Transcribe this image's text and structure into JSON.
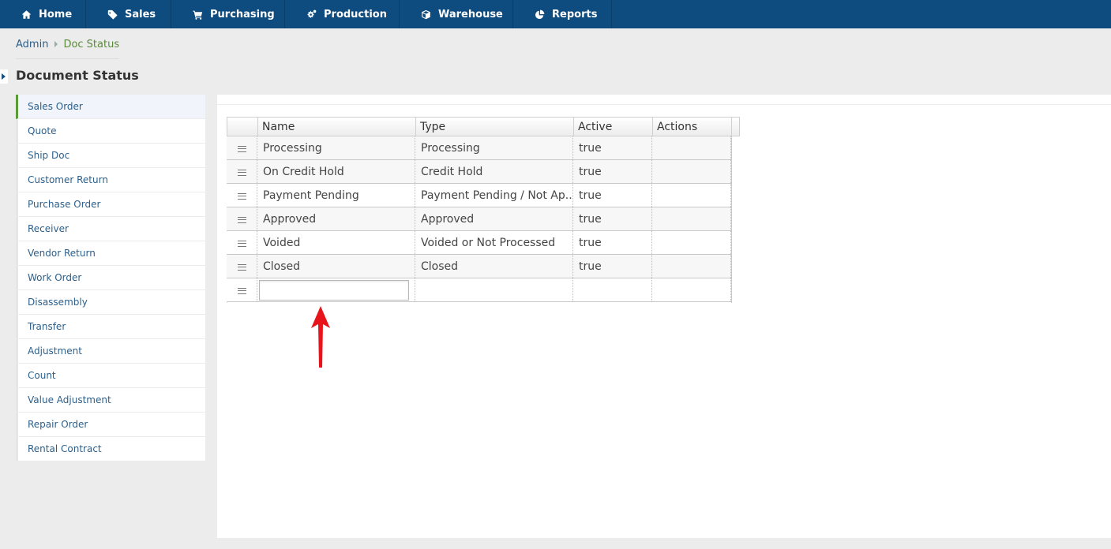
{
  "nav": {
    "items": [
      {
        "label": "Home",
        "icon": "home-icon"
      },
      {
        "label": "Sales",
        "icon": "tag-icon"
      },
      {
        "label": "Purchasing",
        "icon": "cart-icon"
      },
      {
        "label": "Production",
        "icon": "gears-icon"
      },
      {
        "label": "Warehouse",
        "icon": "box-icon"
      },
      {
        "label": "Reports",
        "icon": "pie-chart-icon"
      }
    ],
    "background": "#0e4b7f"
  },
  "breadcrumb": {
    "parent": "Admin",
    "current": "Doc Status"
  },
  "page": {
    "title": "Document Status"
  },
  "sidebar": {
    "items": [
      {
        "label": "Sales Order",
        "active": true
      },
      {
        "label": "Quote"
      },
      {
        "label": "Ship Doc"
      },
      {
        "label": "Customer Return"
      },
      {
        "label": "Purchase Order"
      },
      {
        "label": "Receiver"
      },
      {
        "label": "Vendor Return"
      },
      {
        "label": "Work Order"
      },
      {
        "label": "Disassembly"
      },
      {
        "label": "Transfer"
      },
      {
        "label": "Adjustment"
      },
      {
        "label": "Count"
      },
      {
        "label": "Value Adjustment"
      },
      {
        "label": "Repair Order"
      },
      {
        "label": "Rental Contract"
      }
    ]
  },
  "grid": {
    "columns": [
      "Name",
      "Type",
      "Active",
      "Actions"
    ],
    "rows": [
      {
        "name": "Processing",
        "type": "Processing",
        "active": "true",
        "actions": ""
      },
      {
        "name": "On Credit Hold",
        "type": "Credit Hold",
        "active": "true",
        "actions": ""
      },
      {
        "name": "Payment Pending",
        "type": "Payment Pending / Not Ap...",
        "active": "true",
        "actions": ""
      },
      {
        "name": "Approved",
        "type": "Approved",
        "active": "true",
        "actions": ""
      },
      {
        "name": "Voided",
        "type": "Voided or Not Processed",
        "active": "true",
        "actions": ""
      },
      {
        "name": "Closed",
        "type": "Closed",
        "active": "true",
        "actions": ""
      }
    ],
    "new_row": {
      "name_value": ""
    }
  },
  "colors": {
    "accent_green": "#5b9a3a",
    "link_blue": "#2c5f8a",
    "annotation_arrow": "#e8141c"
  }
}
